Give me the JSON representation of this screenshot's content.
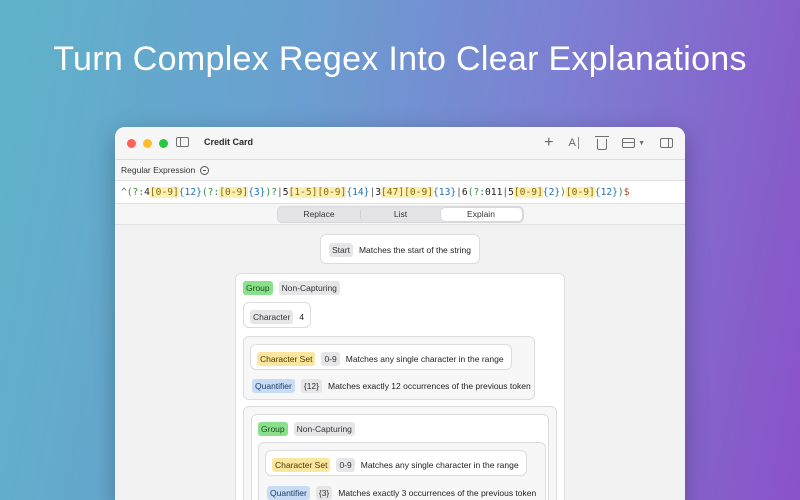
{
  "headline": "Turn Complex Regex Into Clear Explanations",
  "window": {
    "title": "Credit Card",
    "toolbar_icons": [
      "sidebar-icon",
      "plus-icon",
      "text-size-icon",
      "trash-icon",
      "layout-icon",
      "chevron-down-icon",
      "inspector-icon"
    ],
    "toolbar_text_size_glyph": "A"
  },
  "regex": {
    "label": "Regular Expression",
    "tokens": [
      {
        "t": "^",
        "k": "anchor"
      },
      {
        "t": "(?:",
        "k": "grp"
      },
      {
        "t": "4",
        "k": "lit"
      },
      {
        "t": "[0-9]",
        "k": "set"
      },
      {
        "t": "{12}",
        "k": "q"
      },
      {
        "t": "(?:",
        "k": "grp"
      },
      {
        "t": "[0-9]",
        "k": "set"
      },
      {
        "t": "{3}",
        "k": "q"
      },
      {
        "t": ")?",
        "k": "grp"
      },
      {
        "t": "|",
        "k": "alt"
      },
      {
        "t": "5",
        "k": "lit"
      },
      {
        "t": "[1-5]",
        "k": "set"
      },
      {
        "t": "[0-9]",
        "k": "set"
      },
      {
        "t": "{14}",
        "k": "q"
      },
      {
        "t": "|",
        "k": "alt"
      },
      {
        "t": "3",
        "k": "lit"
      },
      {
        "t": "[47]",
        "k": "set"
      },
      {
        "t": "[0-9]",
        "k": "set"
      },
      {
        "t": "{13}",
        "k": "q"
      },
      {
        "t": "|",
        "k": "alt"
      },
      {
        "t": "6",
        "k": "lit"
      },
      {
        "t": "(?:",
        "k": "grp"
      },
      {
        "t": "011",
        "k": "lit"
      },
      {
        "t": "|",
        "k": "alt"
      },
      {
        "t": "5",
        "k": "lit"
      },
      {
        "t": "[0-9]",
        "k": "set"
      },
      {
        "t": "{2}",
        "k": "q"
      },
      {
        "t": ")",
        "k": "grp"
      },
      {
        "t": "[0-9]",
        "k": "set"
      },
      {
        "t": "{12}",
        "k": "q"
      },
      {
        "t": ")",
        "k": "grp"
      },
      {
        "t": "$",
        "k": "dollar"
      }
    ]
  },
  "tabs": [
    "Replace",
    "List",
    "Explain"
  ],
  "active_tab": "Explain",
  "explain": {
    "start": {
      "chip": "Start",
      "desc": "Matches the start of the string"
    },
    "group1": {
      "chip": "Group",
      "type": "Non-Capturing"
    },
    "character": {
      "chip": "Character",
      "value": "4"
    },
    "set1": {
      "chip": "Character Set",
      "range": "0-9",
      "desc": "Matches any single character in the range"
    },
    "quant1": {
      "chip": "Quantifier",
      "value": "{12}",
      "desc": "Matches exactly 12 occurrences of the previous token"
    },
    "group2": {
      "chip": "Group",
      "type": "Non-Capturing"
    },
    "set2": {
      "chip": "Character Set",
      "range": "0-9",
      "desc": "Matches any single character in the range"
    },
    "quant2": {
      "chip": "Quantifier",
      "value": "{3}",
      "desc": "Matches exactly 3 occurrences of the previous token"
    }
  },
  "colors": {
    "group_chip": "#8be08d",
    "set_chip": "#fbe6a0",
    "quantifier_chip": "#c9dcf6",
    "neutral_chip": "#e6e6e8"
  }
}
